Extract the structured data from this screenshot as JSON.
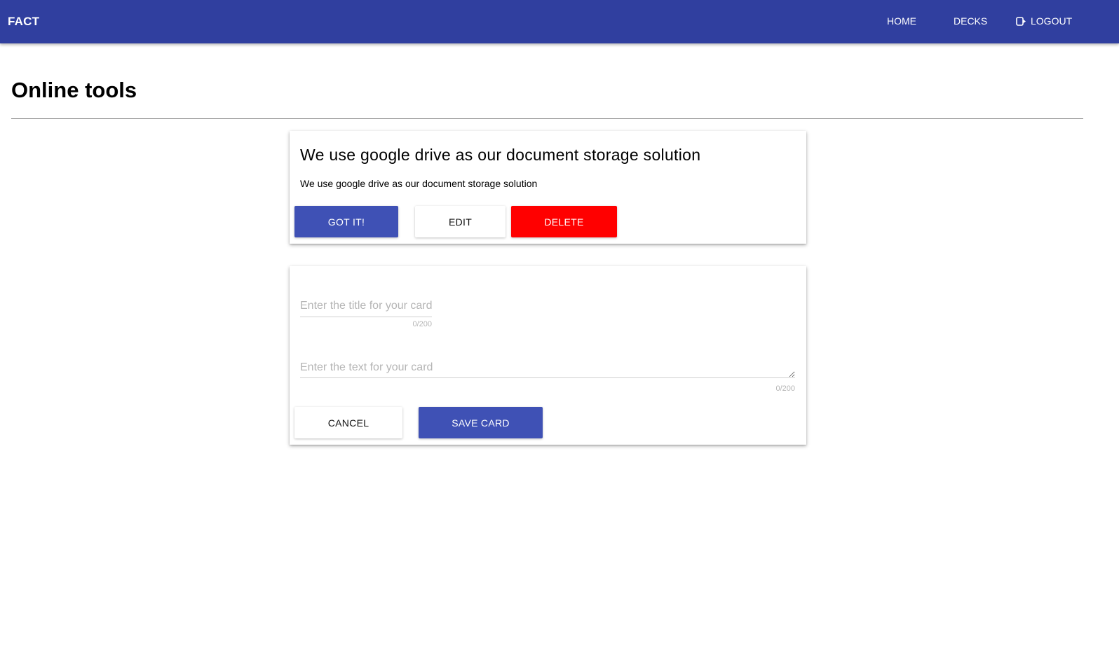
{
  "app": {
    "brand": "FACT",
    "nav": {
      "home": "HOME",
      "decks": "DECKS",
      "logout": "LOGOUT",
      "logout_icon": "logout-icon"
    },
    "colors": {
      "appbar": "#303f9f",
      "primary": "#3f51b5",
      "danger": "#ff0000"
    }
  },
  "page": {
    "title": "Online tools"
  },
  "fact_card": {
    "title": "We use google drive as our document storage solution",
    "text": "We use google drive as our document storage solution",
    "got_it_label": "GOT IT!",
    "edit_label": "EDIT",
    "delete_label": "DELETE"
  },
  "new_card_form": {
    "title_field": {
      "value": "",
      "placeholder": "Enter the title for your card",
      "counter": "0/200"
    },
    "text_field": {
      "value": "",
      "placeholder": "Enter the text for your card",
      "counter": "0/200"
    },
    "cancel_label": "CANCEL",
    "save_label": "SAVE CARD"
  }
}
